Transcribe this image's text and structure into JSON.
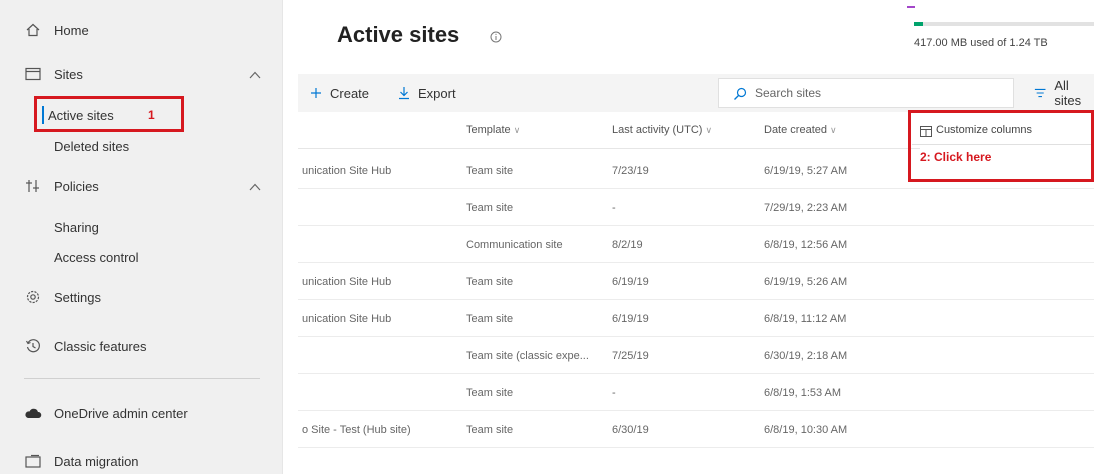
{
  "sidebar": {
    "items": [
      {
        "label": "Home",
        "icon": "home-icon"
      },
      {
        "label": "Sites",
        "icon": "browser-icon"
      },
      {
        "label": "Active sites"
      },
      {
        "label": "Deleted sites"
      },
      {
        "label": "Policies",
        "icon": "policies-icon"
      },
      {
        "label": "Sharing"
      },
      {
        "label": "Access control"
      },
      {
        "label": "Settings",
        "icon": "gear-icon"
      },
      {
        "label": "Classic features",
        "icon": "history-icon"
      },
      {
        "label": "OneDrive admin center",
        "icon": "cloud-icon"
      },
      {
        "label": "Data migration",
        "icon": "migration-icon"
      }
    ],
    "step1_label": "1"
  },
  "header": {
    "title": "Active sites",
    "storage_text": "417.00 MB used of 1.24 TB",
    "storage_fraction": 0.05
  },
  "toolbar": {
    "create_label": "Create",
    "export_label": "Export",
    "search_placeholder": "Search sites",
    "view_label": "All sites"
  },
  "table": {
    "columns": [
      "Template",
      "Last activity (UTC)",
      "Date created"
    ],
    "rows": [
      {
        "name": "unication Site Hub",
        "template": "Team site",
        "last": "7/23/19",
        "created": "6/19/19, 5:27 AM"
      },
      {
        "name": "",
        "template": "Team site",
        "last": "-",
        "created": "7/29/19, 2:23 AM"
      },
      {
        "name": "",
        "template": "Communication site",
        "last": "8/2/19",
        "created": "6/8/19, 12:56 AM"
      },
      {
        "name": "unication Site Hub",
        "template": "Team site",
        "last": "6/19/19",
        "created": "6/19/19, 5:26 AM"
      },
      {
        "name": "unication Site Hub",
        "template": "Team site",
        "last": "6/19/19",
        "created": "6/8/19, 11:12 AM"
      },
      {
        "name": "",
        "template": "Team site (classic expe...",
        "last": "7/25/19",
        "created": "6/30/19, 2:18 AM"
      },
      {
        "name": "",
        "template": "Team site",
        "last": "-",
        "created": "6/8/19, 1:53 AM"
      },
      {
        "name": "o Site - Test (Hub site)",
        "template": "Team site",
        "last": "6/30/19",
        "created": "6/8/19, 10:30 AM"
      }
    ]
  },
  "customize": {
    "label": "Customize columns",
    "annotation": "2: Click here"
  },
  "colors": {
    "accent": "#0078d4",
    "annotation_red": "#d6181f",
    "storage_green": "#00a36c"
  }
}
